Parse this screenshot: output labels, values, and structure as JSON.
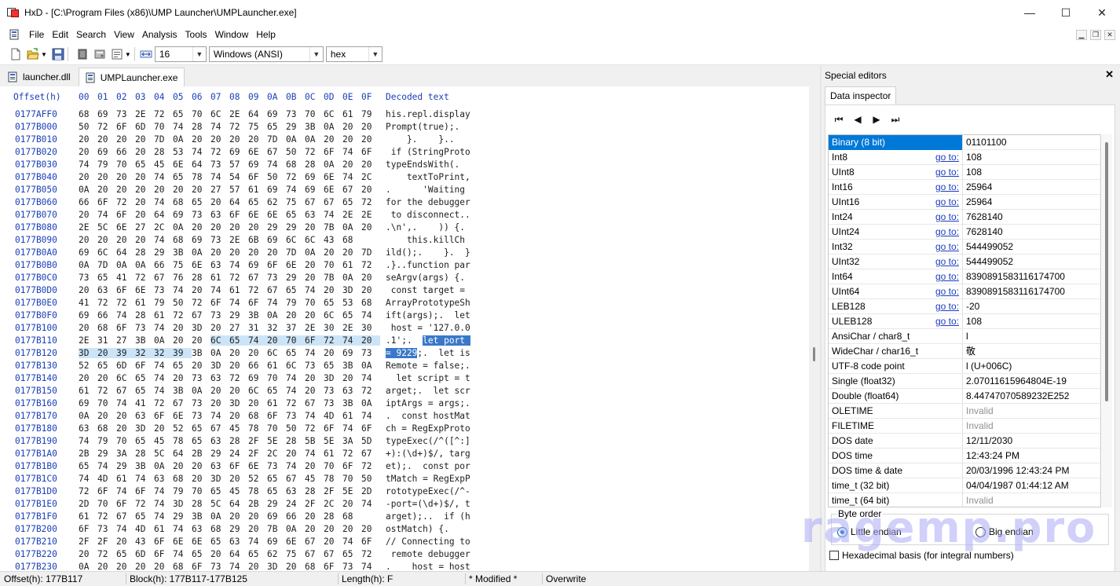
{
  "window": {
    "title": "HxD - [C:\\Program Files (x86)\\UMP Launcher\\UMPLauncher.exe]",
    "minimize": "—",
    "maximize": "☐",
    "close": "✕"
  },
  "menu": [
    "File",
    "Edit",
    "Search",
    "View",
    "Analysis",
    "Tools",
    "Window",
    "Help"
  ],
  "mdi_controls": [
    "▁",
    "❐",
    "✕"
  ],
  "toolbar": {
    "bytes_per_row": "16",
    "charset": "Windows (ANSI)",
    "offset_base": "hex"
  },
  "tabs": [
    {
      "label": "launcher.dll"
    },
    {
      "label": "UMPLauncher.exe"
    }
  ],
  "hex_view": {
    "header_offset": "Offset(h)",
    "header_columns": [
      "00",
      "01",
      "02",
      "03",
      "04",
      "05",
      "06",
      "07",
      "08",
      "09",
      "0A",
      "0B",
      "0C",
      "0D",
      "0E",
      "0F"
    ],
    "header_text": "Decoded text",
    "rows": [
      {
        "offset": "0177AFF0",
        "bytes": [
          "68",
          "69",
          "73",
          "2E",
          "72",
          "65",
          "70",
          "6C",
          "2E",
          "64",
          "69",
          "73",
          "70",
          "6C",
          "61",
          "79"
        ],
        "text": "his.repl.display"
      },
      {
        "offset": "0177B000",
        "bytes": [
          "50",
          "72",
          "6F",
          "6D",
          "70",
          "74",
          "28",
          "74",
          "72",
          "75",
          "65",
          "29",
          "3B",
          "0A",
          "20",
          "20"
        ],
        "text": "Prompt(true);.  "
      },
      {
        "offset": "0177B010",
        "bytes": [
          "20",
          "20",
          "20",
          "20",
          "7D",
          "0A",
          "20",
          "20",
          "20",
          "20",
          "7D",
          "0A",
          "0A",
          "20",
          "20",
          "20"
        ],
        "text": "    }.    }..   "
      },
      {
        "offset": "0177B020",
        "bytes": [
          "20",
          "69",
          "66",
          "20",
          "28",
          "53",
          "74",
          "72",
          "69",
          "6E",
          "67",
          "50",
          "72",
          "6F",
          "74",
          "6F"
        ],
        "text": " if (StringProto"
      },
      {
        "offset": "0177B030",
        "bytes": [
          "74",
          "79",
          "70",
          "65",
          "45",
          "6E",
          "64",
          "73",
          "57",
          "69",
          "74",
          "68",
          "28",
          "0A",
          "20",
          "20"
        ],
        "text": "typeEndsWith(.  "
      },
      {
        "offset": "0177B040",
        "bytes": [
          "20",
          "20",
          "20",
          "20",
          "74",
          "65",
          "78",
          "74",
          "54",
          "6F",
          "50",
          "72",
          "69",
          "6E",
          "74",
          "2C"
        ],
        "text": "    textToPrint,"
      },
      {
        "offset": "0177B050",
        "bytes": [
          "0A",
          "20",
          "20",
          "20",
          "20",
          "20",
          "20",
          "27",
          "57",
          "61",
          "69",
          "74",
          "69",
          "6E",
          "67",
          "20"
        ],
        "text": ".      'Waiting "
      },
      {
        "offset": "0177B060",
        "bytes": [
          "66",
          "6F",
          "72",
          "20",
          "74",
          "68",
          "65",
          "20",
          "64",
          "65",
          "62",
          "75",
          "67",
          "67",
          "65",
          "72"
        ],
        "text": "for the debugger"
      },
      {
        "offset": "0177B070",
        "bytes": [
          "20",
          "74",
          "6F",
          "20",
          "64",
          "69",
          "73",
          "63",
          "6F",
          "6E",
          "6E",
          "65",
          "63",
          "74",
          "2E",
          "2E"
        ],
        "text": " to disconnect.."
      },
      {
        "offset": "0177B080",
        "bytes": [
          "2E",
          "5C",
          "6E",
          "27",
          "2C",
          "0A",
          "20",
          "20",
          "20",
          "20",
          "29",
          "29",
          "20",
          "7B",
          "0A",
          "20"
        ],
        "text": ".\\n',.    )) {. "
      },
      {
        "offset": "0177B090",
        "bytes": [
          "20",
          "20",
          "20",
          "20",
          "74",
          "68",
          "69",
          "73",
          "2E",
          "6B",
          "69",
          "6C",
          "6C",
          "43",
          "68"
        ],
        "text": "    this.killCh"
      },
      {
        "offset": "0177B0A0",
        "bytes": [
          "69",
          "6C",
          "64",
          "28",
          "29",
          "3B",
          "0A",
          "20",
          "20",
          "20",
          "20",
          "7D",
          "0A",
          "20",
          "20",
          "7D"
        ],
        "text": "ild();.    }.  }"
      },
      {
        "offset": "0177B0B0",
        "bytes": [
          "0A",
          "7D",
          "0A",
          "0A",
          "66",
          "75",
          "6E",
          "63",
          "74",
          "69",
          "6F",
          "6E",
          "20",
          "70",
          "61",
          "72"
        ],
        "text": ".}..function par"
      },
      {
        "offset": "0177B0C0",
        "bytes": [
          "73",
          "65",
          "41",
          "72",
          "67",
          "76",
          "28",
          "61",
          "72",
          "67",
          "73",
          "29",
          "20",
          "7B",
          "0A",
          "20"
        ],
        "text": "seArgv(args) {. "
      },
      {
        "offset": "0177B0D0",
        "bytes": [
          "20",
          "63",
          "6F",
          "6E",
          "73",
          "74",
          "20",
          "74",
          "61",
          "72",
          "67",
          "65",
          "74",
          "20",
          "3D",
          "20"
        ],
        "text": " const target = "
      },
      {
        "offset": "0177B0E0",
        "bytes": [
          "41",
          "72",
          "72",
          "61",
          "79",
          "50",
          "72",
          "6F",
          "74",
          "6F",
          "74",
          "79",
          "70",
          "65",
          "53",
          "68"
        ],
        "text": "ArrayPrototypeSh"
      },
      {
        "offset": "0177B0F0",
        "bytes": [
          "69",
          "66",
          "74",
          "28",
          "61",
          "72",
          "67",
          "73",
          "29",
          "3B",
          "0A",
          "20",
          "20",
          "6C",
          "65",
          "74"
        ],
        "text": "ift(args);.  let"
      },
      {
        "offset": "0177B100",
        "bytes": [
          "20",
          "68",
          "6F",
          "73",
          "74",
          "20",
          "3D",
          "20",
          "27",
          "31",
          "32",
          "37",
          "2E",
          "30",
          "2E",
          "30"
        ],
        "text": " host = '127.0.0"
      },
      {
        "offset": "0177B110",
        "bytes": [
          "2E",
          "31",
          "27",
          "3B",
          "0A",
          "20",
          "20",
          "6C",
          "65",
          "74",
          "20",
          "70",
          "6F",
          "72",
          "74",
          "20"
        ],
        "text": ".1';.  let port "
      },
      {
        "offset": "0177B120",
        "bytes": [
          "3D",
          "20",
          "39",
          "32",
          "32",
          "39",
          "3B",
          "0A",
          "20",
          "20",
          "6C",
          "65",
          "74",
          "20",
          "69",
          "73"
        ],
        "text": "= 9229;.  let is"
      },
      {
        "offset": "0177B130",
        "bytes": [
          "52",
          "65",
          "6D",
          "6F",
          "74",
          "65",
          "20",
          "3D",
          "20",
          "66",
          "61",
          "6C",
          "73",
          "65",
          "3B",
          "0A"
        ],
        "text": "Remote = false;."
      },
      {
        "offset": "0177B140",
        "bytes": [
          "20",
          "20",
          "6C",
          "65",
          "74",
          "20",
          "73",
          "63",
          "72",
          "69",
          "70",
          "74",
          "20",
          "3D",
          "20",
          "74"
        ],
        "text": "  let script = t"
      },
      {
        "offset": "0177B150",
        "bytes": [
          "61",
          "72",
          "67",
          "65",
          "74",
          "3B",
          "0A",
          "20",
          "20",
          "6C",
          "65",
          "74",
          "20",
          "73",
          "63",
          "72"
        ],
        "text": "arget;.  let scr"
      },
      {
        "offset": "0177B160",
        "bytes": [
          "69",
          "70",
          "74",
          "41",
          "72",
          "67",
          "73",
          "20",
          "3D",
          "20",
          "61",
          "72",
          "67",
          "73",
          "3B",
          "0A"
        ],
        "text": "iptArgs = args;."
      },
      {
        "offset": "0177B170",
        "bytes": [
          "0A",
          "20",
          "20",
          "63",
          "6F",
          "6E",
          "73",
          "74",
          "20",
          "68",
          "6F",
          "73",
          "74",
          "4D",
          "61",
          "74"
        ],
        "text": ".  const hostMat"
      },
      {
        "offset": "0177B180",
        "bytes": [
          "63",
          "68",
          "20",
          "3D",
          "20",
          "52",
          "65",
          "67",
          "45",
          "78",
          "70",
          "50",
          "72",
          "6F",
          "74",
          "6F"
        ],
        "text": "ch = RegExpProto"
      },
      {
        "offset": "0177B190",
        "bytes": [
          "74",
          "79",
          "70",
          "65",
          "45",
          "78",
          "65",
          "63",
          "28",
          "2F",
          "5E",
          "28",
          "5B",
          "5E",
          "3A",
          "5D"
        ],
        "text": "typeExec(/^([^:]"
      },
      {
        "offset": "0177B1A0",
        "bytes": [
          "2B",
          "29",
          "3A",
          "28",
          "5C",
          "64",
          "2B",
          "29",
          "24",
          "2F",
          "2C",
          "20",
          "74",
          "61",
          "72",
          "67"
        ],
        "text": "+):(\\d+)$/, targ"
      },
      {
        "offset": "0177B1B0",
        "bytes": [
          "65",
          "74",
          "29",
          "3B",
          "0A",
          "20",
          "20",
          "63",
          "6F",
          "6E",
          "73",
          "74",
          "20",
          "70",
          "6F",
          "72"
        ],
        "text": "et);.  const por"
      },
      {
        "offset": "0177B1C0",
        "bytes": [
          "74",
          "4D",
          "61",
          "74",
          "63",
          "68",
          "20",
          "3D",
          "20",
          "52",
          "65",
          "67",
          "45",
          "78",
          "70",
          "50"
        ],
        "text": "tMatch = RegExpP"
      },
      {
        "offset": "0177B1D0",
        "bytes": [
          "72",
          "6F",
          "74",
          "6F",
          "74",
          "79",
          "70",
          "65",
          "45",
          "78",
          "65",
          "63",
          "28",
          "2F",
          "5E",
          "2D"
        ],
        "text": "rototypeExec(/^-"
      },
      {
        "offset": "0177B1E0",
        "bytes": [
          "2D",
          "70",
          "6F",
          "72",
          "74",
          "3D",
          "28",
          "5C",
          "64",
          "2B",
          "29",
          "24",
          "2F",
          "2C",
          "20",
          "74"
        ],
        "text": "-port=(\\d+)$/, t"
      },
      {
        "offset": "0177B1F0",
        "bytes": [
          "61",
          "72",
          "67",
          "65",
          "74",
          "29",
          "3B",
          "0A",
          "20",
          "20",
          "69",
          "66",
          "20",
          "28",
          "68"
        ],
        "text": "arget);..  if (h"
      },
      {
        "offset": "0177B200",
        "bytes": [
          "6F",
          "73",
          "74",
          "4D",
          "61",
          "74",
          "63",
          "68",
          "29",
          "20",
          "7B",
          "0A",
          "20",
          "20",
          "20",
          "20"
        ],
        "text": "ostMatch) {.    "
      },
      {
        "offset": "0177B210",
        "bytes": [
          "2F",
          "2F",
          "20",
          "43",
          "6F",
          "6E",
          "6E",
          "65",
          "63",
          "74",
          "69",
          "6E",
          "67",
          "20",
          "74",
          "6F"
        ],
        "text": "// Connecting to"
      },
      {
        "offset": "0177B220",
        "bytes": [
          "20",
          "72",
          "65",
          "6D",
          "6F",
          "74",
          "65",
          "20",
          "64",
          "65",
          "62",
          "75",
          "67",
          "67",
          "65",
          "72"
        ],
        "text": " remote debugger"
      },
      {
        "offset": "0177B230",
        "bytes": [
          "0A",
          "20",
          "20",
          "20",
          "20",
          "68",
          "6F",
          "73",
          "74",
          "20",
          "3D",
          "20",
          "68",
          "6F",
          "73",
          "74"
        ],
        "text": ".    host = host"
      }
    ]
  },
  "side_panel": {
    "title": "Special editors",
    "close": "✕",
    "tab": "Data inspector",
    "nav": [
      "⏮",
      "◀",
      "▶",
      "⏭"
    ],
    "goto_label": "go to:",
    "rows": [
      {
        "name": "Binary (8 bit)",
        "value": "01101100",
        "goto": false,
        "dim": false
      },
      {
        "name": "Int8",
        "value": "108",
        "goto": true,
        "dim": false
      },
      {
        "name": "UInt8",
        "value": "108",
        "goto": true,
        "dim": false
      },
      {
        "name": "Int16",
        "value": "25964",
        "goto": true,
        "dim": false
      },
      {
        "name": "UInt16",
        "value": "25964",
        "goto": true,
        "dim": false
      },
      {
        "name": "Int24",
        "value": "7628140",
        "goto": true,
        "dim": false
      },
      {
        "name": "UInt24",
        "value": "7628140",
        "goto": true,
        "dim": false
      },
      {
        "name": "Int32",
        "value": "544499052",
        "goto": true,
        "dim": false
      },
      {
        "name": "UInt32",
        "value": "544499052",
        "goto": true,
        "dim": false
      },
      {
        "name": "Int64",
        "value": "8390891583116174700",
        "goto": true,
        "dim": false
      },
      {
        "name": "UInt64",
        "value": "8390891583116174700",
        "goto": true,
        "dim": false
      },
      {
        "name": "LEB128",
        "value": "-20",
        "goto": true,
        "dim": false
      },
      {
        "name": "ULEB128",
        "value": "108",
        "goto": true,
        "dim": false
      },
      {
        "name": "AnsiChar / char8_t",
        "value": "l",
        "goto": false,
        "dim": false
      },
      {
        "name": "WideChar / char16_t",
        "value": "敬",
        "goto": false,
        "dim": false
      },
      {
        "name": "UTF-8 code point",
        "value": "l (U+006C)",
        "goto": false,
        "dim": false
      },
      {
        "name": "Single (float32)",
        "value": "2.07011615964804E-19",
        "goto": false,
        "dim": false
      },
      {
        "name": "Double (float64)",
        "value": "8.44747070589232E252",
        "goto": false,
        "dim": false
      },
      {
        "name": "OLETIME",
        "value": "Invalid",
        "goto": false,
        "dim": true
      },
      {
        "name": "FILETIME",
        "value": "Invalid",
        "goto": false,
        "dim": true
      },
      {
        "name": "DOS date",
        "value": "12/11/2030",
        "goto": false,
        "dim": false
      },
      {
        "name": "DOS time",
        "value": "12:43:24 PM",
        "goto": false,
        "dim": false
      },
      {
        "name": "DOS time & date",
        "value": "20/03/1996 12:43:24 PM",
        "goto": false,
        "dim": false
      },
      {
        "name": "time_t (32 bit)",
        "value": "04/04/1987 01:44:12 AM",
        "goto": false,
        "dim": false
      },
      {
        "name": "time_t (64 bit)",
        "value": "Invalid",
        "goto": false,
        "dim": true
      }
    ],
    "byte_order": {
      "legend": "Byte order",
      "little": "Little endian",
      "big": "Big endian",
      "selected": "little"
    },
    "hex_basis": "Hexadecimal basis (for integral numbers)"
  },
  "watermark": "ragemp.pro",
  "status": {
    "offset": "Offset(h): 177B117",
    "block": "Block(h): 177B117-177B125",
    "length": "Length(h): F",
    "modified": "* Modified *",
    "mode": "Overwrite"
  }
}
